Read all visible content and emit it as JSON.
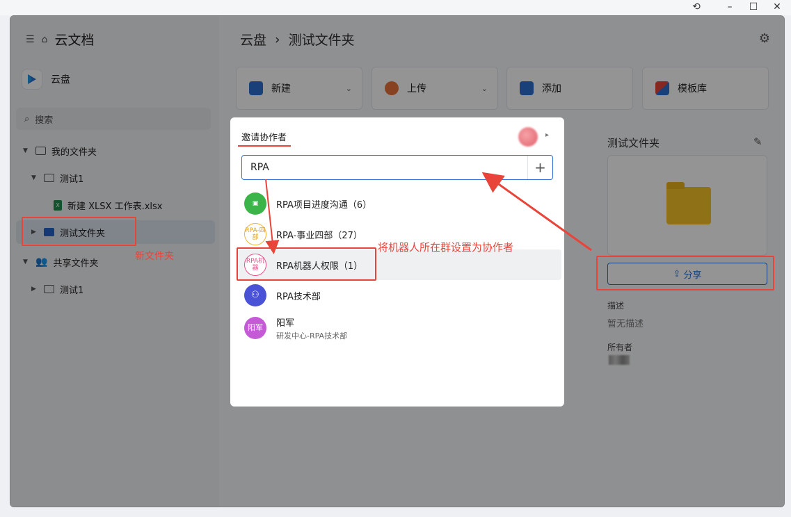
{
  "window": {
    "history_icon": "history-icon",
    "minimize": "–",
    "maximize": "☐",
    "close": "✕"
  },
  "sidebar": {
    "app_title": "云文档",
    "cloud_label": "云盘",
    "search_placeholder": "搜索",
    "tree": [
      {
        "label": "我的文件夹"
      },
      {
        "label": "测试1"
      },
      {
        "label": "新建 XLSX 工作表.xlsx"
      },
      {
        "label": "测试文件夹"
      },
      {
        "label": "共享文件夹"
      },
      {
        "label": "测试1"
      }
    ],
    "note_new_folder": "新文件夹"
  },
  "main": {
    "breadcrumb": [
      "云盘",
      "测试文件夹"
    ],
    "actions": [
      {
        "label": "新建",
        "color": "#2d6fd3"
      },
      {
        "label": "上传",
        "color": "#e8743a"
      },
      {
        "label": "添加",
        "color": "#2d6fd3"
      },
      {
        "label": "模板库",
        "color": "#e8443a"
      }
    ],
    "detail": {
      "title": "测试文件夹",
      "share_label": "分享",
      "desc_label": "描述",
      "desc_value": "暂无描述",
      "owner_label": "所有者"
    }
  },
  "modal": {
    "title": "邀请协作者",
    "search_value": "RPA",
    "plus": "+",
    "results": [
      {
        "name": "RPA项目进度沟通（6）",
        "avatar_text": "",
        "avatar_color": "#3bb54a"
      },
      {
        "name": "RPA-事业四部（27）",
        "avatar_text": "RPA-四部",
        "avatar_color": "#f2b531"
      },
      {
        "name": "RPA机器人权限（1）",
        "avatar_text": "RPA机器",
        "avatar_color": "#e8508c"
      },
      {
        "name": "RPA技术部",
        "avatar_text": "",
        "avatar_color": "#4a53d6"
      },
      {
        "name": "阳军",
        "sub": "研发中心-RPA技术部",
        "avatar_text": "阳军",
        "avatar_color": "#c45ad6"
      }
    ]
  },
  "annotation": {
    "set_collaborator": "将机器人所在群设置为协作者"
  }
}
